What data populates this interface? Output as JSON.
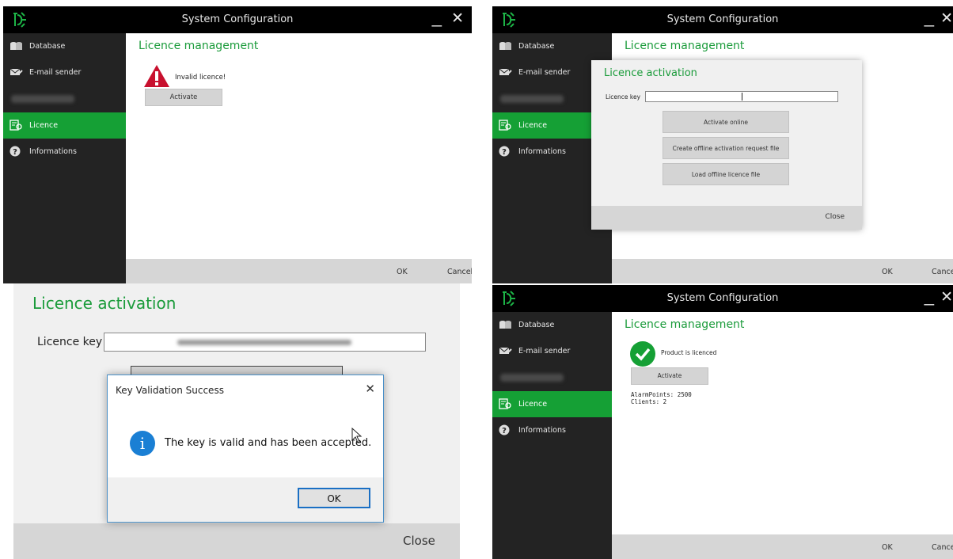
{
  "colors": {
    "accent": "#15a035",
    "sidebar": "#232323",
    "titlebar": "#000000",
    "error": "#c8102e",
    "info": "#1a7fd4"
  },
  "window": {
    "title": "System Configuration",
    "minimize_glyph": "_",
    "close_glyph": "✕"
  },
  "sidebar": {
    "items": [
      {
        "label": "Database",
        "icon": "database-icon"
      },
      {
        "label": "E-mail sender",
        "icon": "envelope-icon"
      },
      {
        "label": "",
        "icon": "blurred-item-icon"
      },
      {
        "label": "Licence",
        "icon": "licence-icon"
      },
      {
        "label": "Informations",
        "icon": "question-icon"
      }
    ]
  },
  "footer": {
    "ok": "OK",
    "cancel": "Cancel"
  },
  "panel_invalid": {
    "heading": "Licence management",
    "status": "Invalid licence!",
    "activate": "Activate"
  },
  "panel_activation_dialog": {
    "heading_bg": "Licence management",
    "title": "Licence activation",
    "key_label": "Licence key",
    "key_value": "",
    "buttons": [
      "Activate online",
      "Create offline activation request file",
      "Load offline licence file"
    ],
    "close": "Close"
  },
  "panel_zoom": {
    "title": "Licence activation",
    "key_label": "Licence key",
    "close": "Close",
    "msgbox": {
      "title": "Key Validation Success",
      "message": "The key is valid and has been accepted.",
      "ok": "OK",
      "close_glyph": "✕",
      "info_glyph": "i"
    }
  },
  "panel_licenced": {
    "heading": "Licence management",
    "status": "Product is licenced",
    "activate": "Activate",
    "details": [
      "AlarmPoints: 2500",
      "Clients: 2"
    ]
  }
}
